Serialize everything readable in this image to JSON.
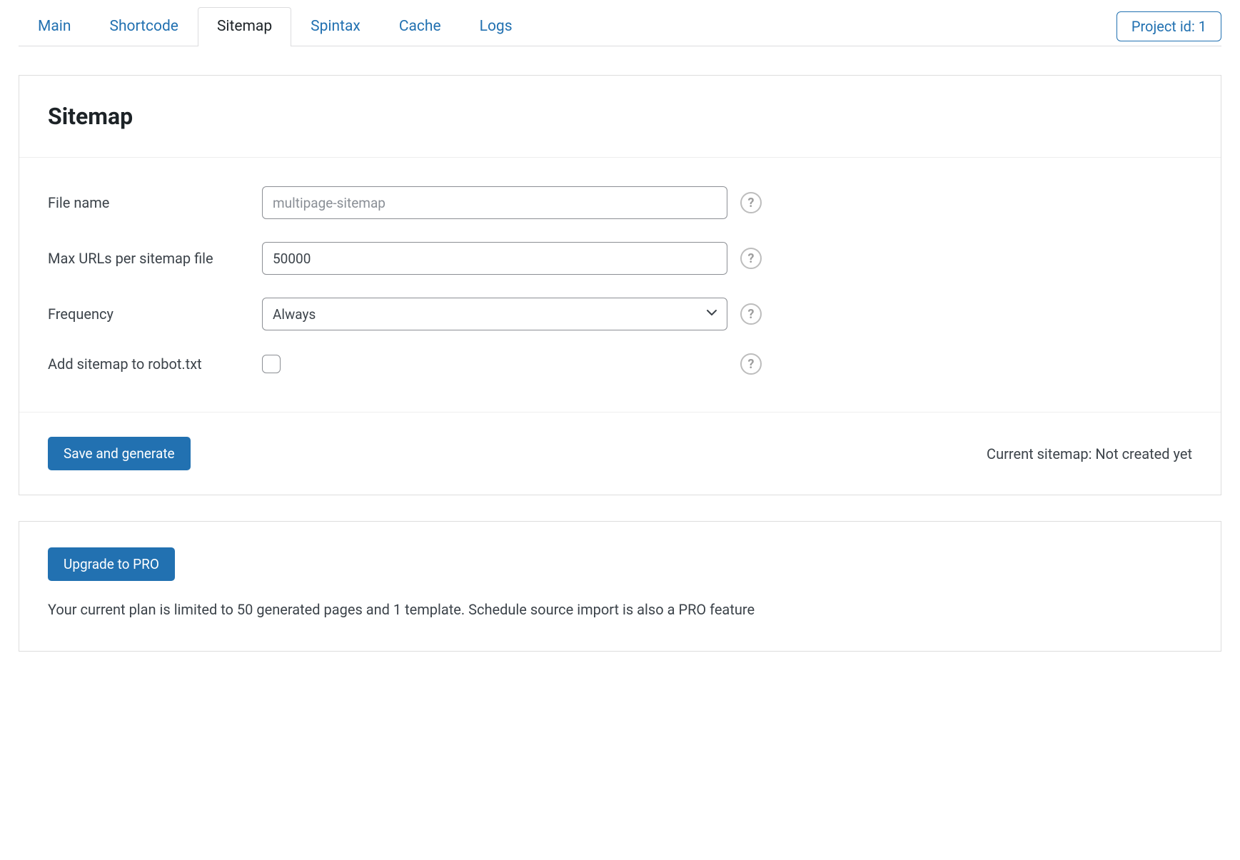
{
  "tabs": {
    "main": "Main",
    "shortcode": "Shortcode",
    "sitemap": "Sitemap",
    "spintax": "Spintax",
    "cache": "Cache",
    "logs": "Logs"
  },
  "project_badge": "Project id: 1",
  "panel": {
    "title": "Sitemap",
    "fields": {
      "file_name_label": "File name",
      "file_name_placeholder": "multipage-sitemap",
      "max_urls_label": "Max URLs per sitemap file",
      "max_urls_value": "50000",
      "frequency_label": "Frequency",
      "frequency_value": "Always",
      "robot_label": "Add sitemap to robot.txt"
    },
    "save_button": "Save and generate",
    "status": "Current sitemap: Not created yet"
  },
  "upgrade": {
    "button": "Upgrade to PRO",
    "description": "Your current plan is limited to 50 generated pages and 1 template. Schedule source import is also a PRO feature"
  },
  "help_glyph": "?"
}
